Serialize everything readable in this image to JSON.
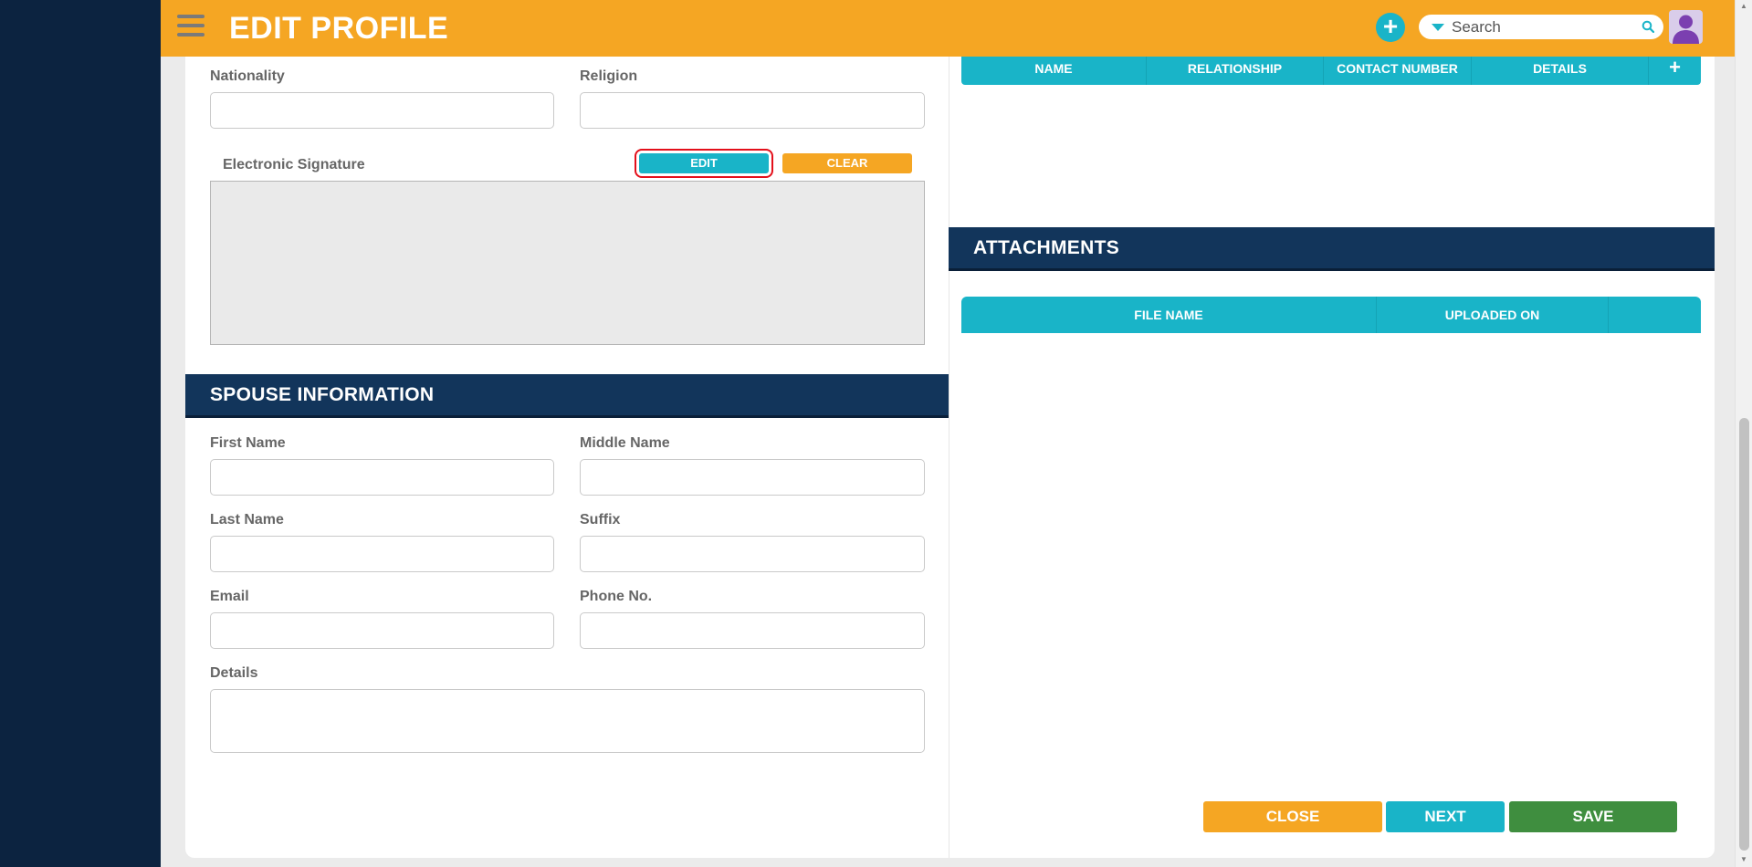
{
  "header": {
    "title": "EDIT PROFILE",
    "search_placeholder": "Search",
    "add_icon": "+"
  },
  "personal": {
    "nationality_label": "Nationality",
    "religion_label": "Religion",
    "signature_label": "Electronic Signature",
    "edit_label": "EDIT",
    "clear_label": "CLEAR"
  },
  "spouse": {
    "section_title": "SPOUSE INFORMATION",
    "first_name_label": "First Name",
    "middle_name_label": "Middle Name",
    "last_name_label": "Last Name",
    "suffix_label": "Suffix",
    "email_label": "Email",
    "phone_label": "Phone No.",
    "details_label": "Details"
  },
  "contacts_table": {
    "columns": [
      "NAME",
      "RELATIONSHIP",
      "CONTACT NUMBER",
      "DETAILS"
    ],
    "add_label": "+"
  },
  "attachments": {
    "section_title": "ATTACHMENTS",
    "columns": [
      "FILE NAME",
      "UPLOADED ON",
      ""
    ]
  },
  "footer": {
    "close_label": "CLOSE",
    "next_label": "NEXT",
    "save_label": "SAVE"
  },
  "colors": {
    "topbar": "#f5a623",
    "sidebar": "#0c2340",
    "section_header": "#12355b",
    "table_header": "#19b4c8",
    "save": "#3f8e3f"
  },
  "icons": [
    "hamburger-menu-icon",
    "add-circle-icon",
    "dropdown-caret-icon",
    "search-icon",
    "user-avatar-icon"
  ]
}
